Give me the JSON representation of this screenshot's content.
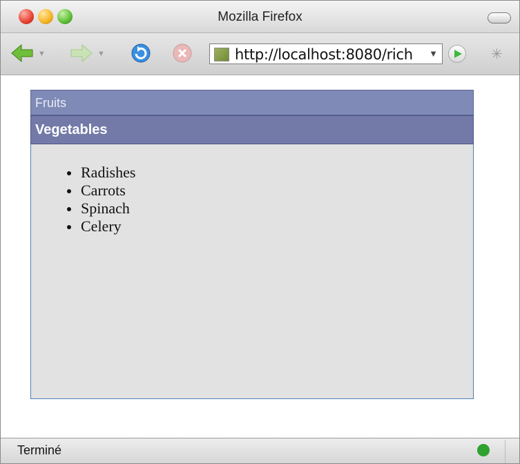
{
  "window": {
    "title": "Mozilla Firefox"
  },
  "toolbar": {
    "url": "http://localhost:8080/rich",
    "back_icon": "back-arrow-icon",
    "forward_icon": "forward-arrow-icon",
    "reload_icon": "reload-icon",
    "stop_icon": "stop-icon",
    "go_icon": "go-arrow-icon"
  },
  "accordion": {
    "panels": [
      {
        "label": "Fruits"
      },
      {
        "label": "Vegetables",
        "items": [
          "Radishes",
          "Carrots",
          "Spinach",
          "Celery"
        ]
      }
    ]
  },
  "statusbar": {
    "text": "Terminé"
  },
  "colors": {
    "header_inactive": "#7f8ab6",
    "header_active": "#737aa8",
    "panel_bg": "#e2e2e2",
    "panel_border": "#4b7fb3"
  }
}
